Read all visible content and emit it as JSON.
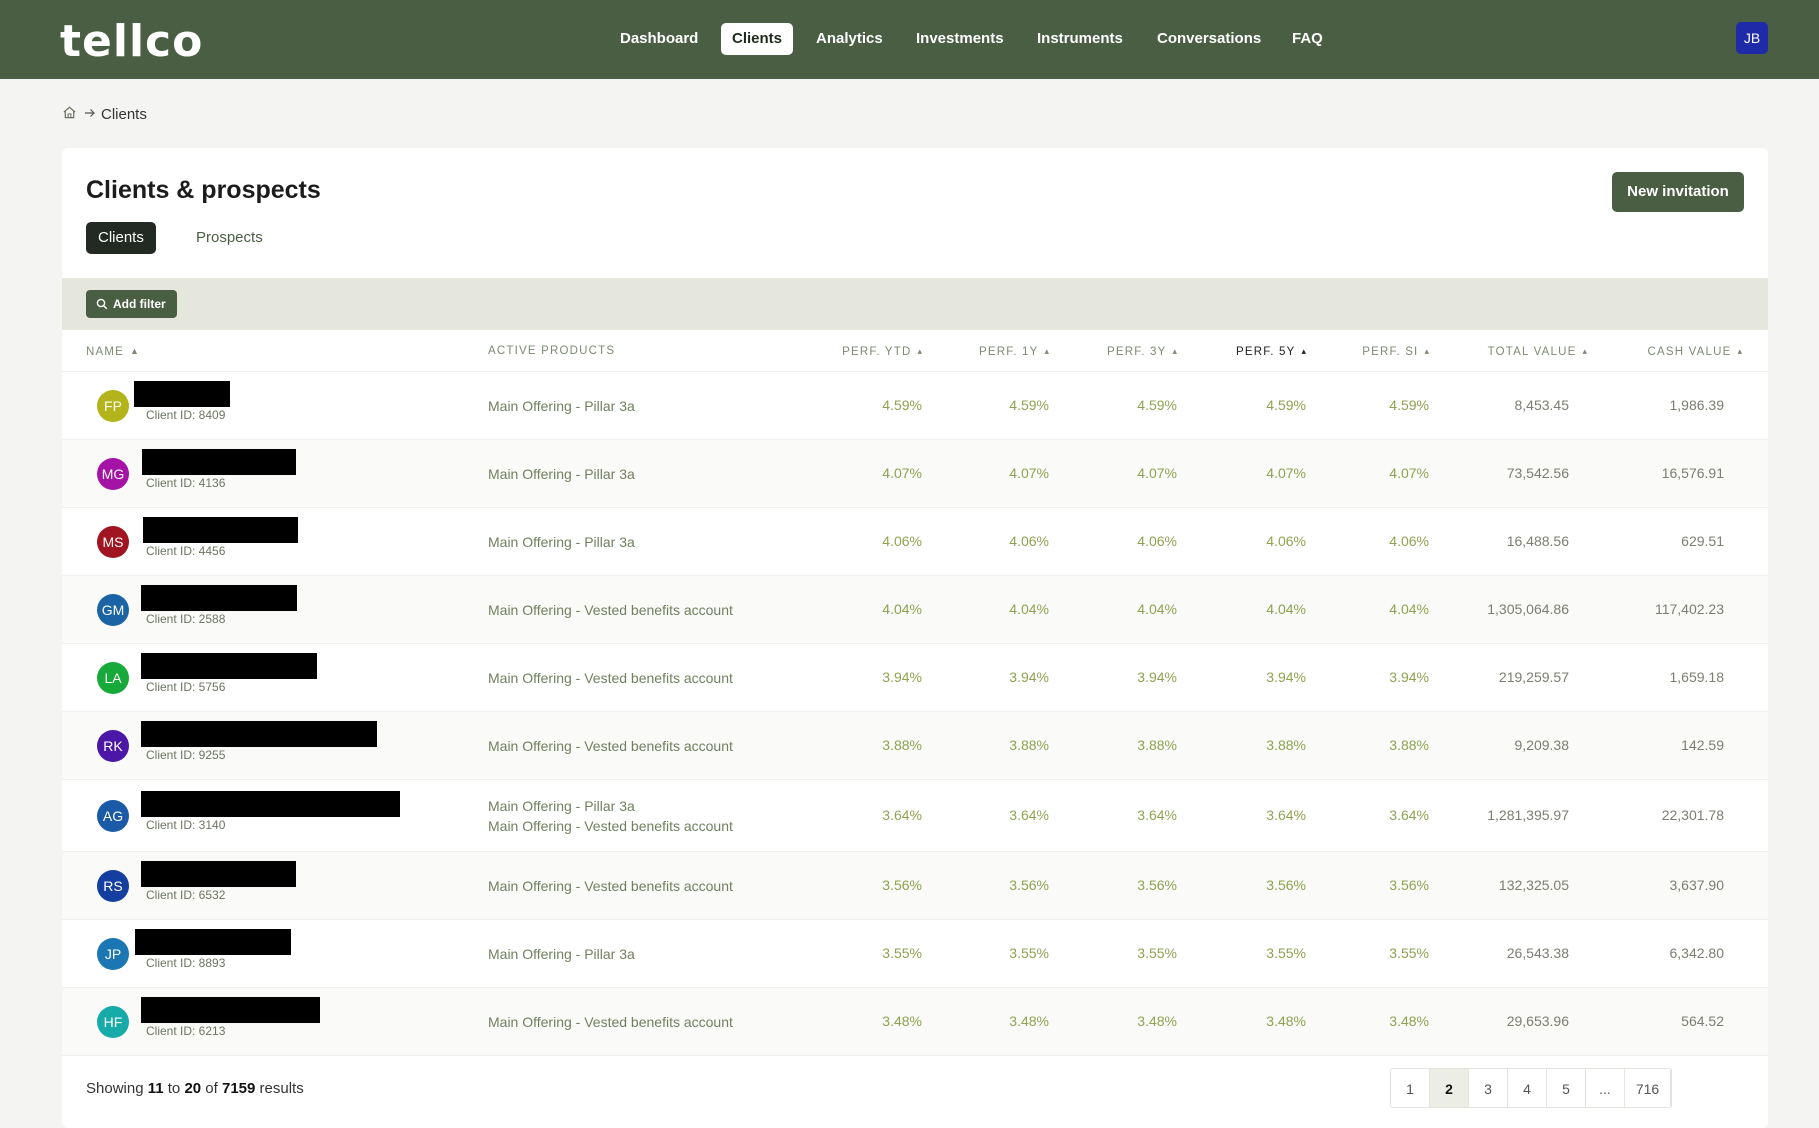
{
  "app": {
    "logo": "tellco",
    "user_initials": "JB",
    "nav": [
      "Dashboard",
      "Clients",
      "Analytics",
      "Investments",
      "Instruments",
      "Conversations",
      "FAQ"
    ],
    "active_nav": "Clients"
  },
  "breadcrumb": {
    "current": "Clients"
  },
  "page": {
    "title": "Clients & prospects",
    "new_invitation": "New invitation",
    "tabs": [
      "Clients",
      "Prospects"
    ],
    "active_tab": "Clients",
    "add_filter": "Add filter"
  },
  "table": {
    "headers": {
      "name": "NAME",
      "products": "ACTIVE PRODUCTS",
      "ytd": "PERF. YTD",
      "y1": "PERF. 1Y",
      "y3": "PERF. 3Y",
      "y5": "PERF. 5Y",
      "si": "PERF. SI",
      "total": "TOTAL VALUE",
      "cash": "CASH VALUE"
    },
    "rows": [
      {
        "initials": "FP",
        "color": "#b3b41a",
        "client_id": "Client ID: 8409",
        "products": [
          "Main Offering - Pillar 3a"
        ],
        "perf": "4.59%",
        "total": "8,453.45",
        "cash": "1,986.39"
      },
      {
        "initials": "MG",
        "color": "#a413a6",
        "client_id": "Client ID: 4136",
        "products": [
          "Main Offering - Pillar 3a"
        ],
        "perf": "4.07%",
        "total": "73,542.56",
        "cash": "16,576.91"
      },
      {
        "initials": "MS",
        "color": "#a11521",
        "client_id": "Client ID: 4456",
        "products": [
          "Main Offering - Pillar 3a"
        ],
        "perf": "4.06%",
        "total": "16,488.56",
        "cash": "629.51"
      },
      {
        "initials": "GM",
        "color": "#1a64a6",
        "client_id": "Client ID: 2588",
        "products": [
          "Main Offering - Vested benefits account"
        ],
        "perf": "4.04%",
        "total": "1,305,064.86",
        "cash": "117,402.23"
      },
      {
        "initials": "LA",
        "color": "#17a93a",
        "client_id": "Client ID: 5756",
        "products": [
          "Main Offering - Vested benefits account"
        ],
        "perf": "3.94%",
        "total": "219,259.57",
        "cash": "1,659.18"
      },
      {
        "initials": "RK",
        "color": "#4a17a6",
        "client_id": "Client ID: 9255",
        "products": [
          "Main Offering - Vested benefits account"
        ],
        "perf": "3.88%",
        "total": "9,209.38",
        "cash": "142.59"
      },
      {
        "initials": "AG",
        "color": "#1a5aa6",
        "client_id": "Client ID: 3140",
        "products": [
          "Main Offering - Pillar 3a",
          "Main Offering - Vested benefits account"
        ],
        "perf": "3.64%",
        "total": "1,281,395.97",
        "cash": "22,301.78"
      },
      {
        "initials": "RS",
        "color": "#153ea1",
        "client_id": "Client ID: 6532",
        "products": [
          "Main Offering - Vested benefits account"
        ],
        "perf": "3.56%",
        "total": "132,325.05",
        "cash": "3,637.90"
      },
      {
        "initials": "JP",
        "color": "#1a77b3",
        "client_id": "Client ID: 8893",
        "products": [
          "Main Offering - Pillar 3a"
        ],
        "perf": "3.55%",
        "total": "26,543.38",
        "cash": "6,342.80"
      },
      {
        "initials": "HF",
        "color": "#16aaa8",
        "client_id": "Client ID: 6213",
        "products": [
          "Main Offering - Vested benefits account"
        ],
        "perf": "3.48%",
        "total": "29,653.96",
        "cash": "564.52"
      }
    ]
  },
  "footer": {
    "showing": "Showing",
    "from": "11",
    "to_word": "to",
    "to": "20",
    "of_word": "of",
    "total": "7159",
    "results": "results",
    "pages": [
      "1",
      "2",
      "3",
      "4",
      "5",
      "...",
      "716"
    ],
    "active_page": "2"
  }
}
